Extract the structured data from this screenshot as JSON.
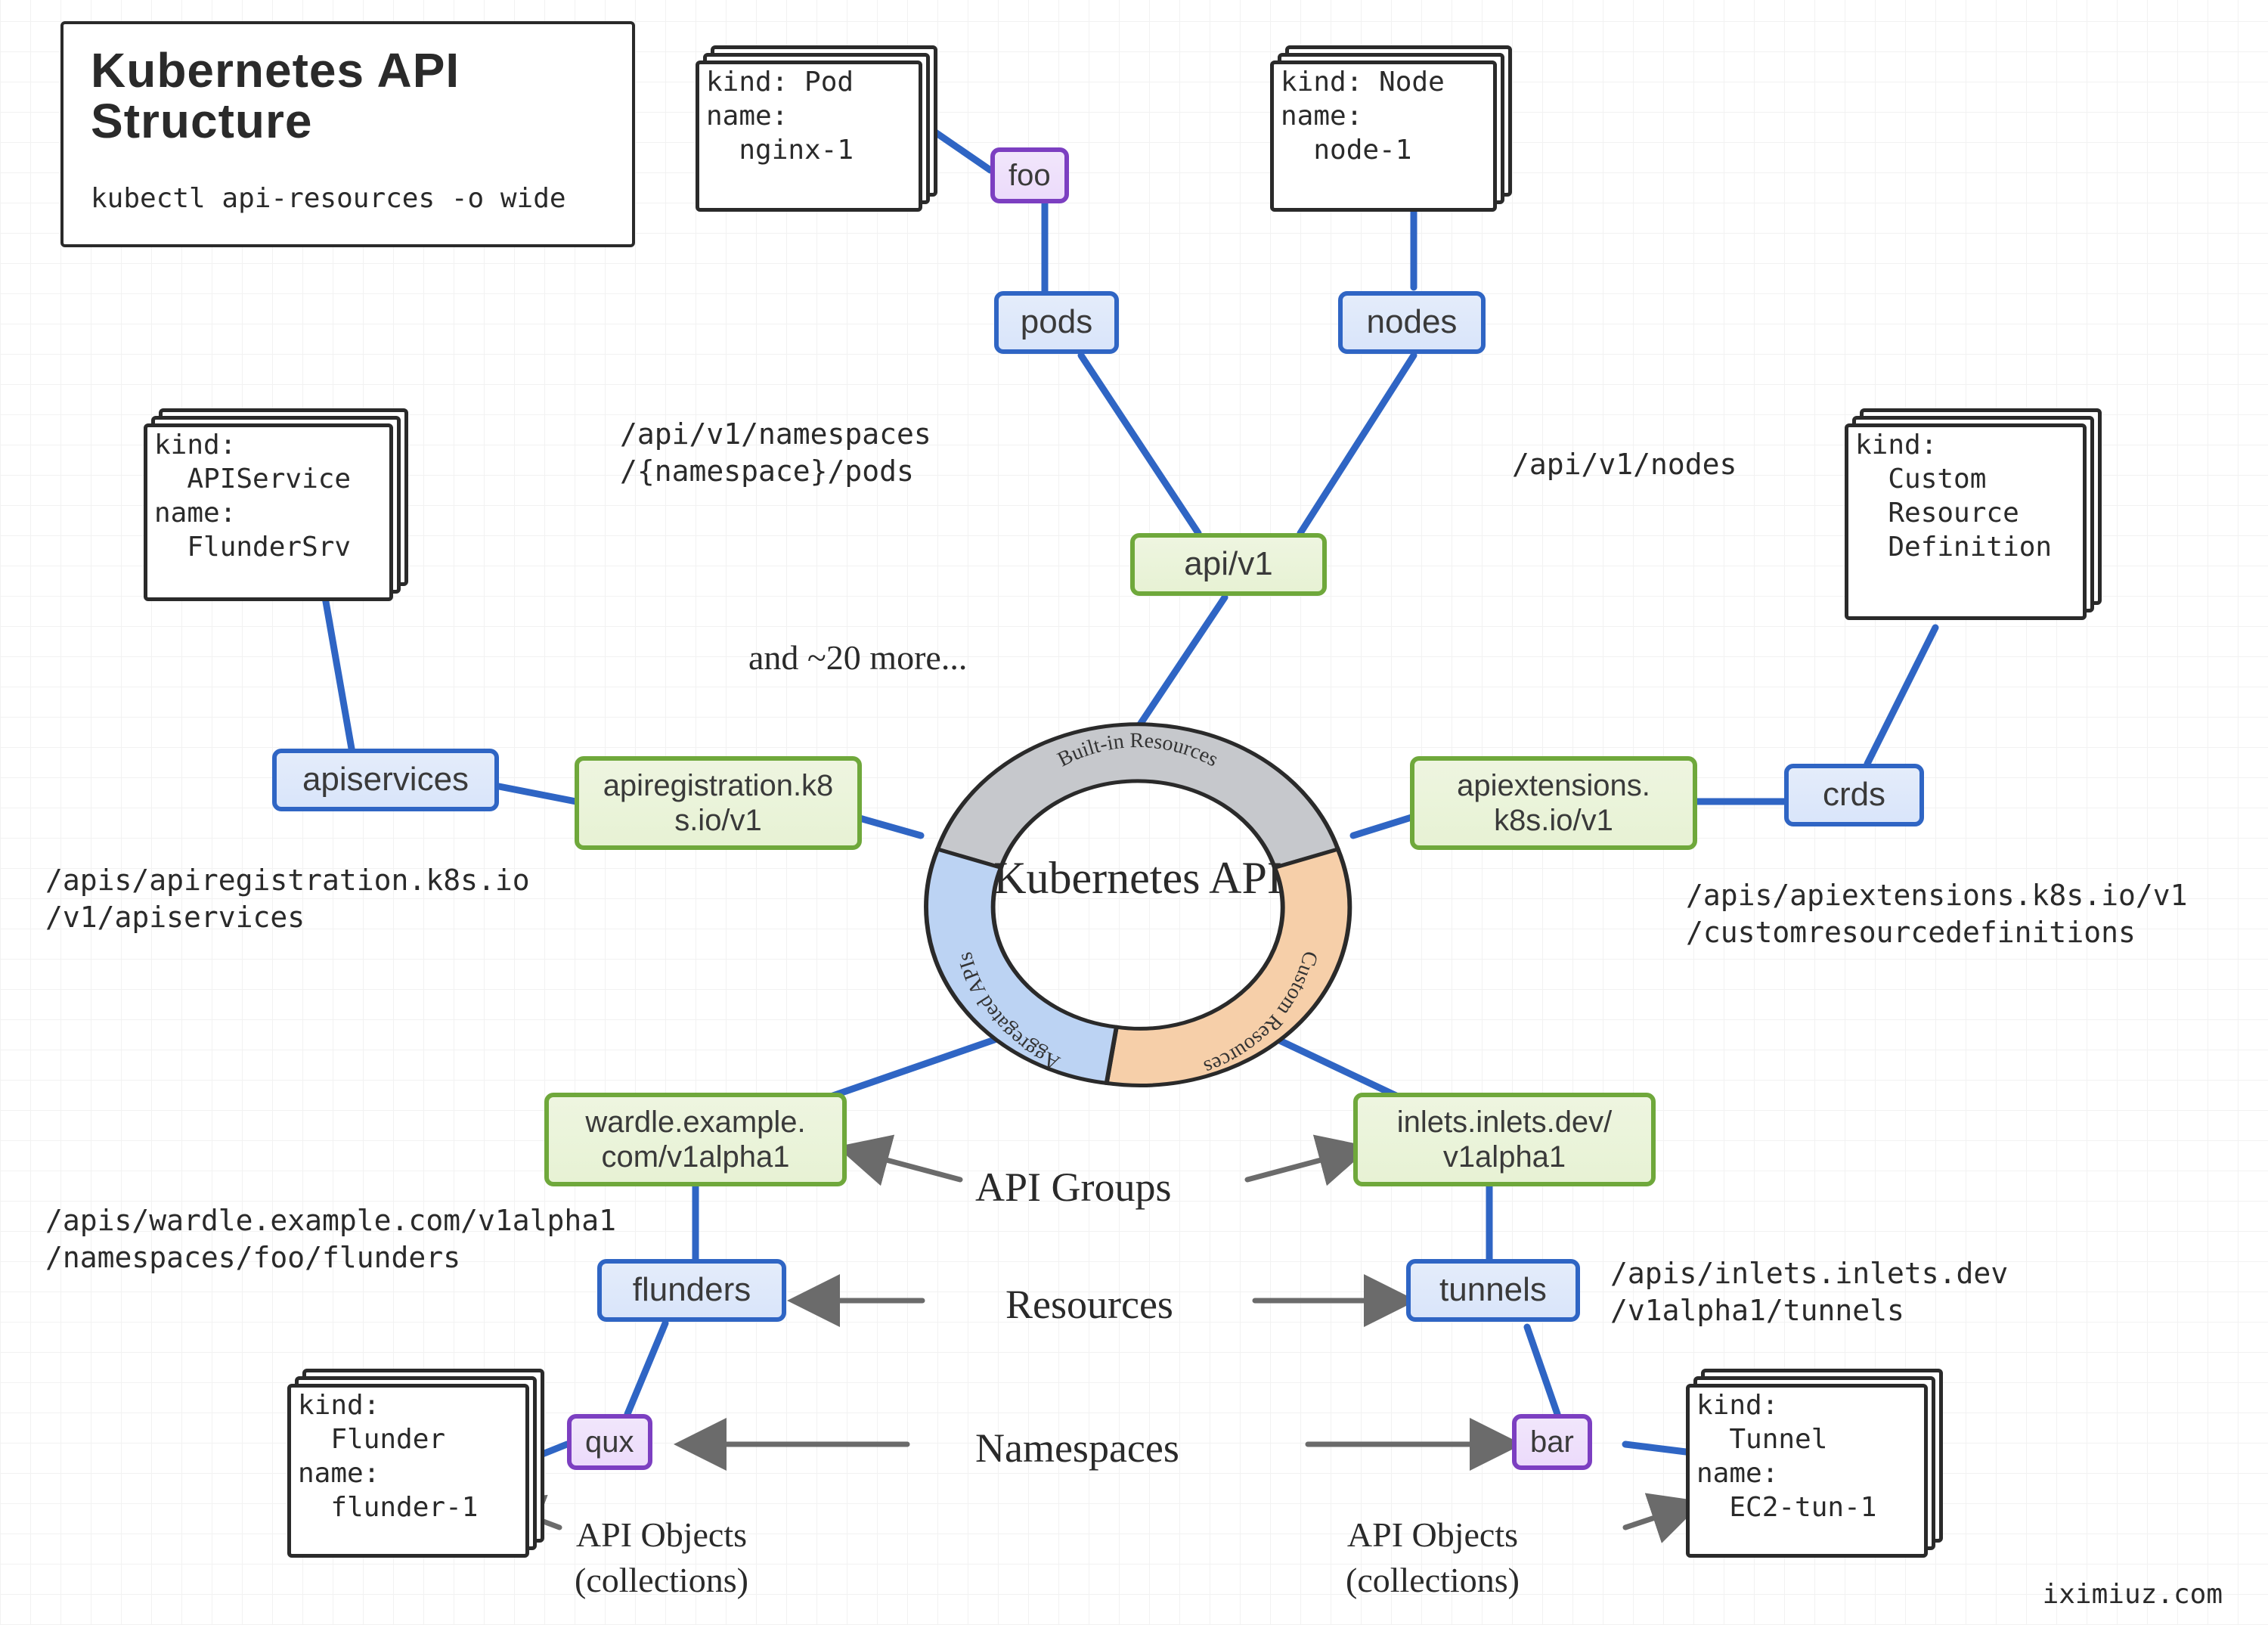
{
  "title": {
    "heading": "Kubernetes API\nStructure",
    "command": "kubectl api-resources -o wide"
  },
  "center": {
    "label": "Kubernetes\nAPI",
    "segments": {
      "builtin": "Built-in\nResources",
      "custom": "Custom\nResources",
      "aggregated": "Aggregated\nAPIs"
    }
  },
  "groups": {
    "core": "api/v1",
    "apireg": "apiregistration.k8\ns.io/v1",
    "apiext": "apiextensions.\nk8s.io/v1",
    "wardle": "wardle.example.\ncom/v1alpha1",
    "inlets": "inlets.inlets.dev/\nv1alpha1"
  },
  "resources": {
    "pods": "pods",
    "nodes": "nodes",
    "apiservices": "apiservices",
    "crds": "crds",
    "flunders": "flunders",
    "tunnels": "tunnels"
  },
  "namespaces": {
    "foo": "foo",
    "qux": "qux",
    "bar": "bar"
  },
  "objects": {
    "pod": "kind: Pod\nname:\n  nginx-1",
    "node": "kind: Node\nname:\n  node-1",
    "apiservice": "kind:\n  APIService\nname:\n  FlunderSrv",
    "crd": "kind:\n  Custom\n  Resource\n  Definition",
    "flunder": "kind:\n  Flunder\nname:\n  flunder-1",
    "tunnel": "kind:\n  Tunnel\nname:\n  EC2-tun-1"
  },
  "paths": {
    "pods": "/api/v1/namespaces\n/{namespace}/pods",
    "nodes": "/api/v1/nodes",
    "apiservices": "/apis/apiregistration.k8s.io\n/v1/apiservices",
    "crds": "/apis/apiextensions.k8s.io/v1\n/customresourcedefinitions",
    "wardle": "/apis/wardle.example.com/v1alpha1\n/namespaces/foo/flunders",
    "inlets": "/apis/inlets.inlets.dev\n/v1alpha1/tunnels"
  },
  "annotations": {
    "and_more": "and ~20 more...",
    "api_groups": "API Groups",
    "resources": "Resources",
    "namespaces": "Namespaces",
    "api_objects_left": "API Objects\n(collections)",
    "api_objects_right": "API Objects\n(collections)"
  },
  "credit": "iximiuz.com",
  "colors": {
    "green": "#6fa83b",
    "blue": "#2f65c4",
    "purple": "#7c3fc1",
    "grey": "#6b6b6b",
    "ring_top": "#c6c8cc",
    "ring_right": "#f6cfa9",
    "ring_left": "#bcd3f3"
  }
}
